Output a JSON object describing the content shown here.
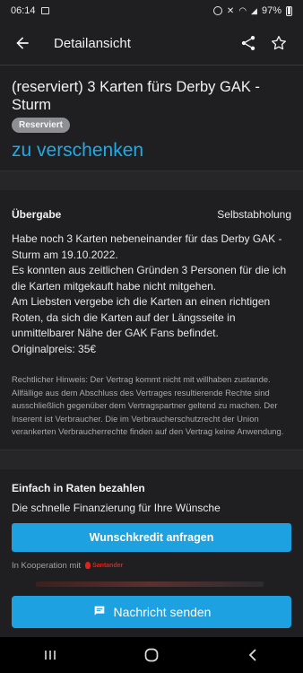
{
  "status_bar": {
    "time": "06:14",
    "battery": "97%"
  },
  "app_bar": {
    "title": "Detailansicht",
    "icons": [
      "back-arrow-icon",
      "share-icon",
      "star-icon"
    ]
  },
  "ad": {
    "title": "(reserviert) 3 Karten fürs Derby GAK -Sturm",
    "badge": "Reserviert",
    "price": "zu verschenken"
  },
  "details": {
    "delivery_label": "Übergabe",
    "delivery_value": "Selbstabholung",
    "description": [
      "Habe noch 3 Karten nebeneinander für das Derby GAK - Sturm am 19.10.2022.",
      "Es konnten aus zeitlichen Gründen 3 Personen für die ich die Karten mitgekauft habe nicht mitgehen.",
      "Am Liebsten vergebe ich die Karten an einen richtigen Roten, da sich die Karten auf der Längsseite in unmittelbarer Nähe der GAK Fans befindet.",
      "Originalpreis: 35€"
    ],
    "legal": "Rechtlicher Hinweis: Der Vertrag kommt nicht mit willhaben zustande. Allfällige aus dem Abschluss des Vertrages resultierende Rechte sind ausschließlich gegenüber dem Vertragspartner geltend zu machen. Der Inserent ist Verbraucher. Die im Verbraucherschutzrecht der Union verankerten Verbraucherrechte finden auf den Vertrag keine Anwendung."
  },
  "finance": {
    "heading": "Einfach in Raten bezahlen",
    "subheading": "Die schnelle Finanzierung  für Ihre Wünsche",
    "button_label": "Wunschkredit anfragen",
    "cooperation_text": "In Kooperation mit",
    "partner": "Santander"
  },
  "bottom": {
    "message_button": "Nachricht senden"
  },
  "colors": {
    "accent": "#1da1e0",
    "price": "#22a9e6",
    "badge_bg": "#8d8f93",
    "background": "#1f1f21"
  }
}
